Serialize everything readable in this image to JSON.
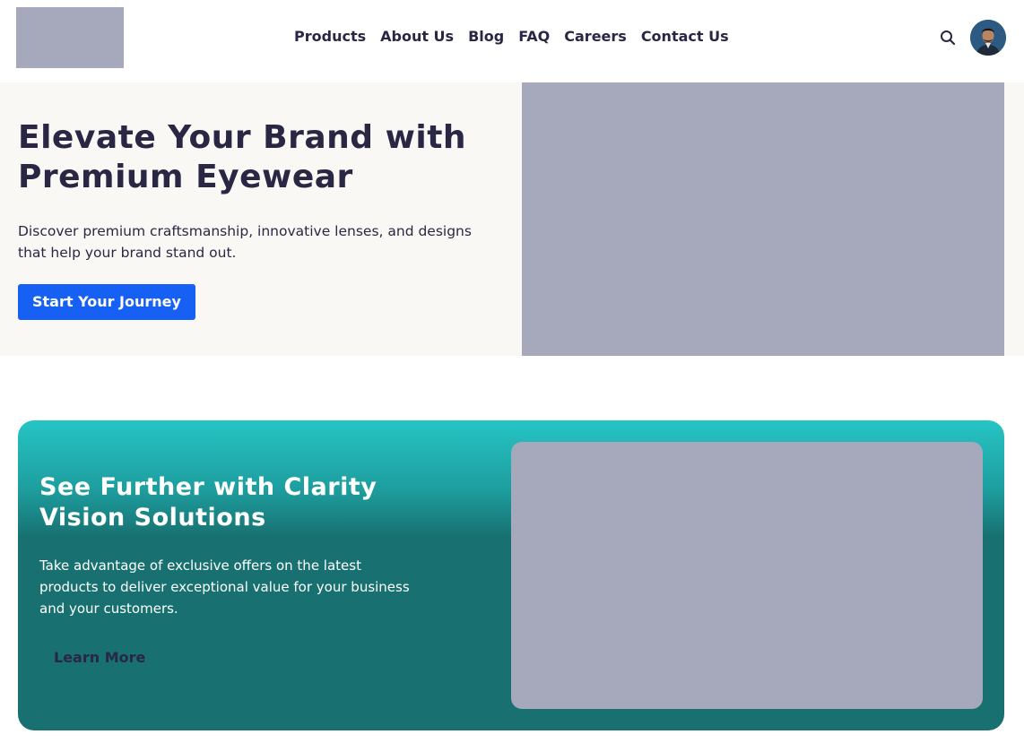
{
  "header": {
    "logo_icon": "logo-placeholder",
    "nav": [
      {
        "label": "Products"
      },
      {
        "label": "About Us"
      },
      {
        "label": "Blog"
      },
      {
        "label": "FAQ"
      },
      {
        "label": "Careers"
      },
      {
        "label": "Contact Us"
      }
    ],
    "search_icon": "search-icon",
    "avatar_icon": "user-avatar"
  },
  "hero": {
    "title": "Elevate Your Brand with Premium Eyewear",
    "description": "Discover premium craftsmanship, innovative lenses, and designs that help your brand stand out.",
    "cta_label": "Start Your Journey",
    "accent_color": "#1660f3"
  },
  "promo": {
    "title": "See Further with Clarity Vision Solutions",
    "description": "Take advantage of exclusive offers on the latest products to deliver exceptional value for your business and your customers.",
    "cta_label": "Learn More",
    "gradient_top": "#26c4c4",
    "gradient_bottom": "#187070"
  },
  "colors": {
    "text_dark": "#2a2745",
    "placeholder": "#a6a9bc",
    "hero_bg": "#faf8f4"
  }
}
